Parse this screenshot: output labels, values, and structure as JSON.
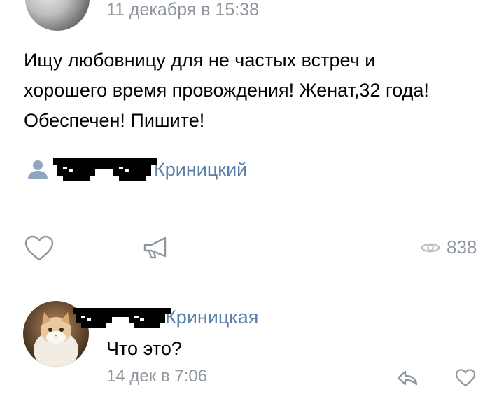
{
  "post": {
    "date": "11 декабря в 15:38",
    "text_lines": [
      "Ищу любовницу для не частых встреч и",
      "хорошего время провождения! Женат,32 года!",
      "Обеспечен! Пишите!"
    ],
    "author_name": "Криницкий",
    "author_icon": "person-icon"
  },
  "actions": {
    "like_icon": "heart-icon",
    "share_icon": "megaphone-icon",
    "views_icon": "eye-icon",
    "views_count": "838"
  },
  "comment": {
    "author_name": "Криницкая",
    "text": "Что это?",
    "date": "14 дек в 7:06",
    "reply_icon": "reply-icon",
    "like_icon": "heart-icon"
  },
  "colors": {
    "link_blue": "#5b7fa6",
    "meta_gray": "#8f969e",
    "divider": "#e3e4e8"
  }
}
